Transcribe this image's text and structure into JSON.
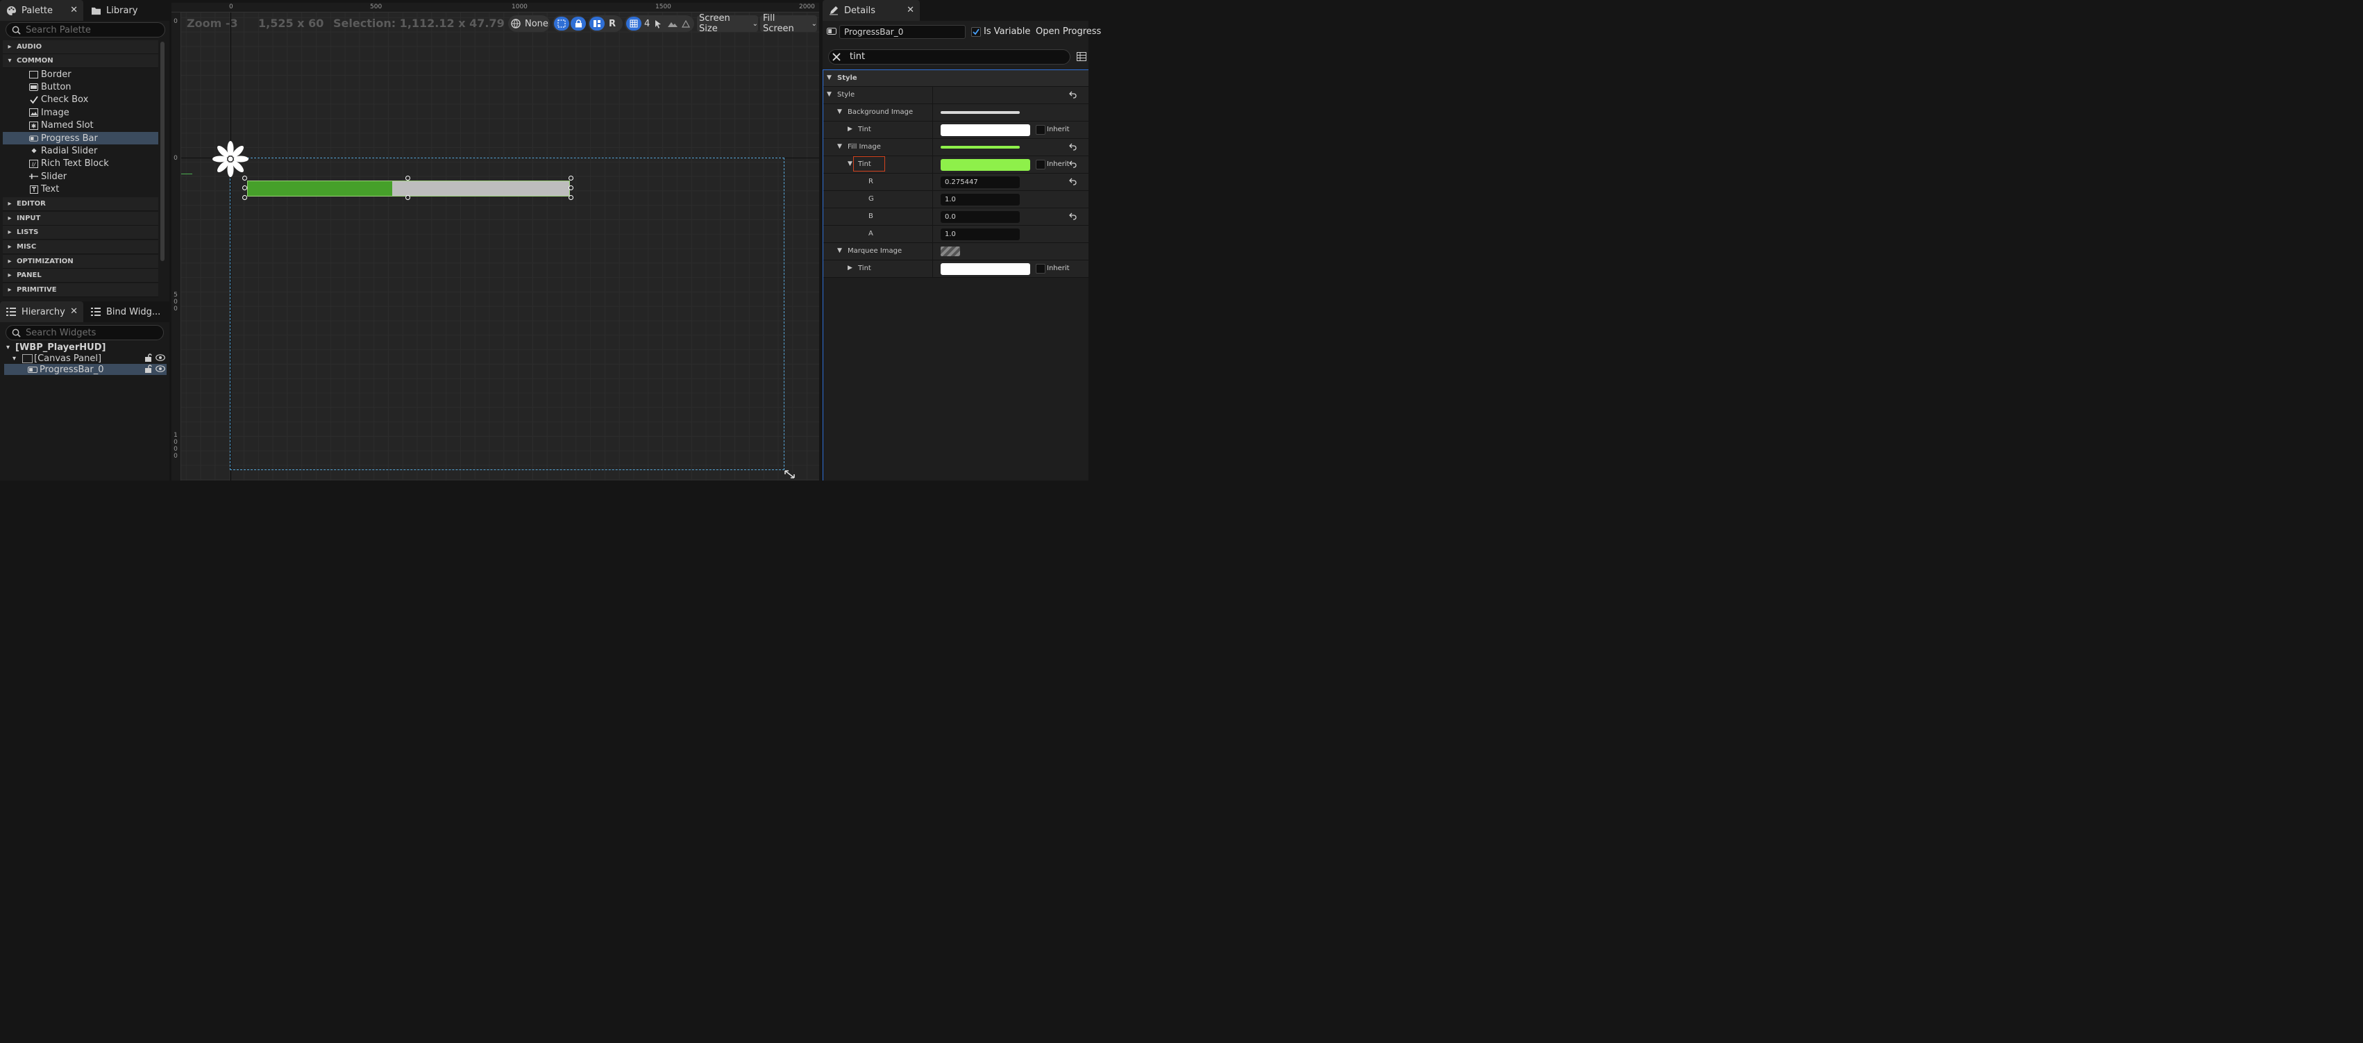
{
  "palette": {
    "tab_label": "Palette",
    "library_tab_label": "Library",
    "search_placeholder": "Search Palette",
    "categories_top": [
      "AUDIO",
      "COMMON"
    ],
    "common_items": [
      "Border",
      "Button",
      "Check Box",
      "Image",
      "Named Slot",
      "Progress Bar",
      "Radial Slider",
      "Rich Text Block",
      "Slider",
      "Text"
    ],
    "common_icons": [
      "border-icon",
      "button-icon",
      "check-box-icon",
      "image-icon",
      "named-slot-icon",
      "progress-bar-icon",
      "radial-slider-icon",
      "rich-text-icon",
      "slider-icon",
      "text-icon"
    ],
    "selected_item": "Progress Bar",
    "categories_bottom": [
      "EDITOR",
      "INPUT",
      "LISTS",
      "MISC",
      "OPTIMIZATION",
      "PANEL",
      "PRIMITIVE"
    ]
  },
  "hierarchy": {
    "tab_label": "Hierarchy",
    "bind_tab_label": "Bind Widg...",
    "search_placeholder": "Search Widgets",
    "root": "[WBP_PlayerHUD]",
    "canvas": "[Canvas Panel]",
    "widget": "ProgressBar_0"
  },
  "viewport": {
    "zoom": "Zoom -3",
    "size": "1,525 x 60",
    "selection": "Selection: 1,112.12 x 47.79",
    "ruler_h": [
      "0",
      "500",
      "1000",
      "1500",
      "2000"
    ],
    "ruler_v_top": "0",
    "ruler_v_mid": "0",
    "ruler_v_500": [
      "5",
      "0",
      "0"
    ],
    "ruler_v_1000": [
      "1",
      "0",
      "0",
      "0"
    ],
    "toolbar": {
      "none_label": "None",
      "r_label": "R",
      "grid_value": "4",
      "screen_size": "Screen Size",
      "fill_screen": "Fill Screen"
    },
    "progress_percent": 45,
    "fill_color": "#46a02a",
    "background_color": "#bdbdbd"
  },
  "details": {
    "tab_label": "Details",
    "widget_name": "ProgressBar_0",
    "is_variable_label": "Is Variable",
    "is_variable_checked": true,
    "open_button": "Open Progress",
    "filter_text": "tint",
    "section": "Style",
    "rows": {
      "style": "Style",
      "background_image": "Background Image",
      "bg_tint": "Tint",
      "fill_image": "Fill Image",
      "fill_tint": "Tint",
      "r_label": "R",
      "r_value": "0.275447",
      "g_label": "G",
      "g_value": "1.0",
      "b_label": "B",
      "b_value": "0.0",
      "a_label": "A",
      "a_value": "1.0",
      "marquee_image": "Marquee Image",
      "marquee_tint": "Tint",
      "inherit": "Inherit"
    },
    "colors": {
      "bg_tint": "#ffffff",
      "fill_tint": "#8ef04a",
      "marquee_tint": "#ffffff",
      "highlight": "#d2431f"
    }
  }
}
